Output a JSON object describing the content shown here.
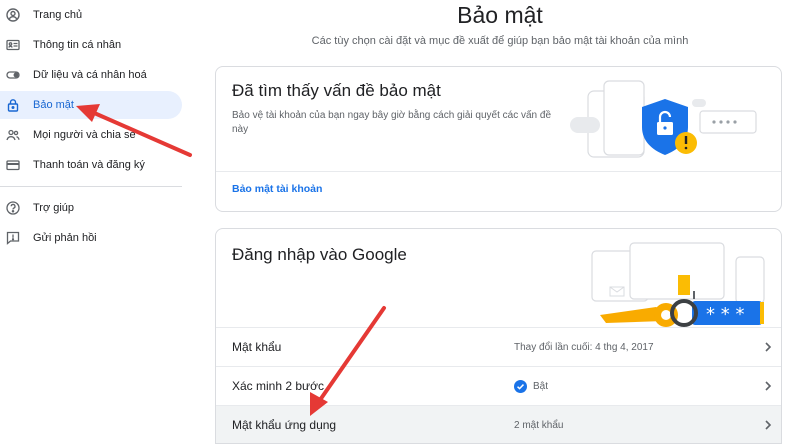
{
  "sidebar": {
    "items": [
      {
        "label": "Trang chủ",
        "icon": "home-icon"
      },
      {
        "label": "Thông tin cá nhân",
        "icon": "id-card-icon"
      },
      {
        "label": "Dữ liệu và cá nhân hoá",
        "icon": "toggle-icon"
      },
      {
        "label": "Bảo mật",
        "icon": "lock-icon",
        "active": true
      },
      {
        "label": "Mọi người và chia sẻ",
        "icon": "people-icon"
      },
      {
        "label": "Thanh toán và đăng ký",
        "icon": "credit-card-icon"
      }
    ],
    "bottom_items": [
      {
        "label": "Trợ giúp",
        "icon": "help-icon"
      },
      {
        "label": "Gửi phản hồi",
        "icon": "feedback-icon"
      }
    ]
  },
  "header": {
    "title": "Bảo mật",
    "subtitle": "Các tùy chọn cài đặt và mục đề xuất để giúp bạn bảo mật tài khoản của mình"
  },
  "issues_card": {
    "title": "Đã tìm thấy vấn đề bảo mật",
    "description": "Bảo vệ tài khoản của bạn ngay bây giờ bằng cách giải quyết các vấn đề này",
    "link": "Bảo mật tài khoản"
  },
  "signin_card": {
    "title": "Đăng nhập vào Google",
    "rows": [
      {
        "label": "Mật khẩu",
        "value": "Thay đổi lần cuối: 4 thg 4, 2017"
      },
      {
        "label": "Xác minh 2 bước",
        "value": "Bật",
        "status_icon": "check-circle-icon"
      },
      {
        "label": "Mật khẩu ứng dụng",
        "value": "2 mật khẩu"
      }
    ]
  },
  "colors": {
    "accent": "#1a73e8",
    "active_bg": "#e8f0fe",
    "arrow": "#e53935",
    "shield": "#1a73e8",
    "warning": "#fbbc04"
  }
}
